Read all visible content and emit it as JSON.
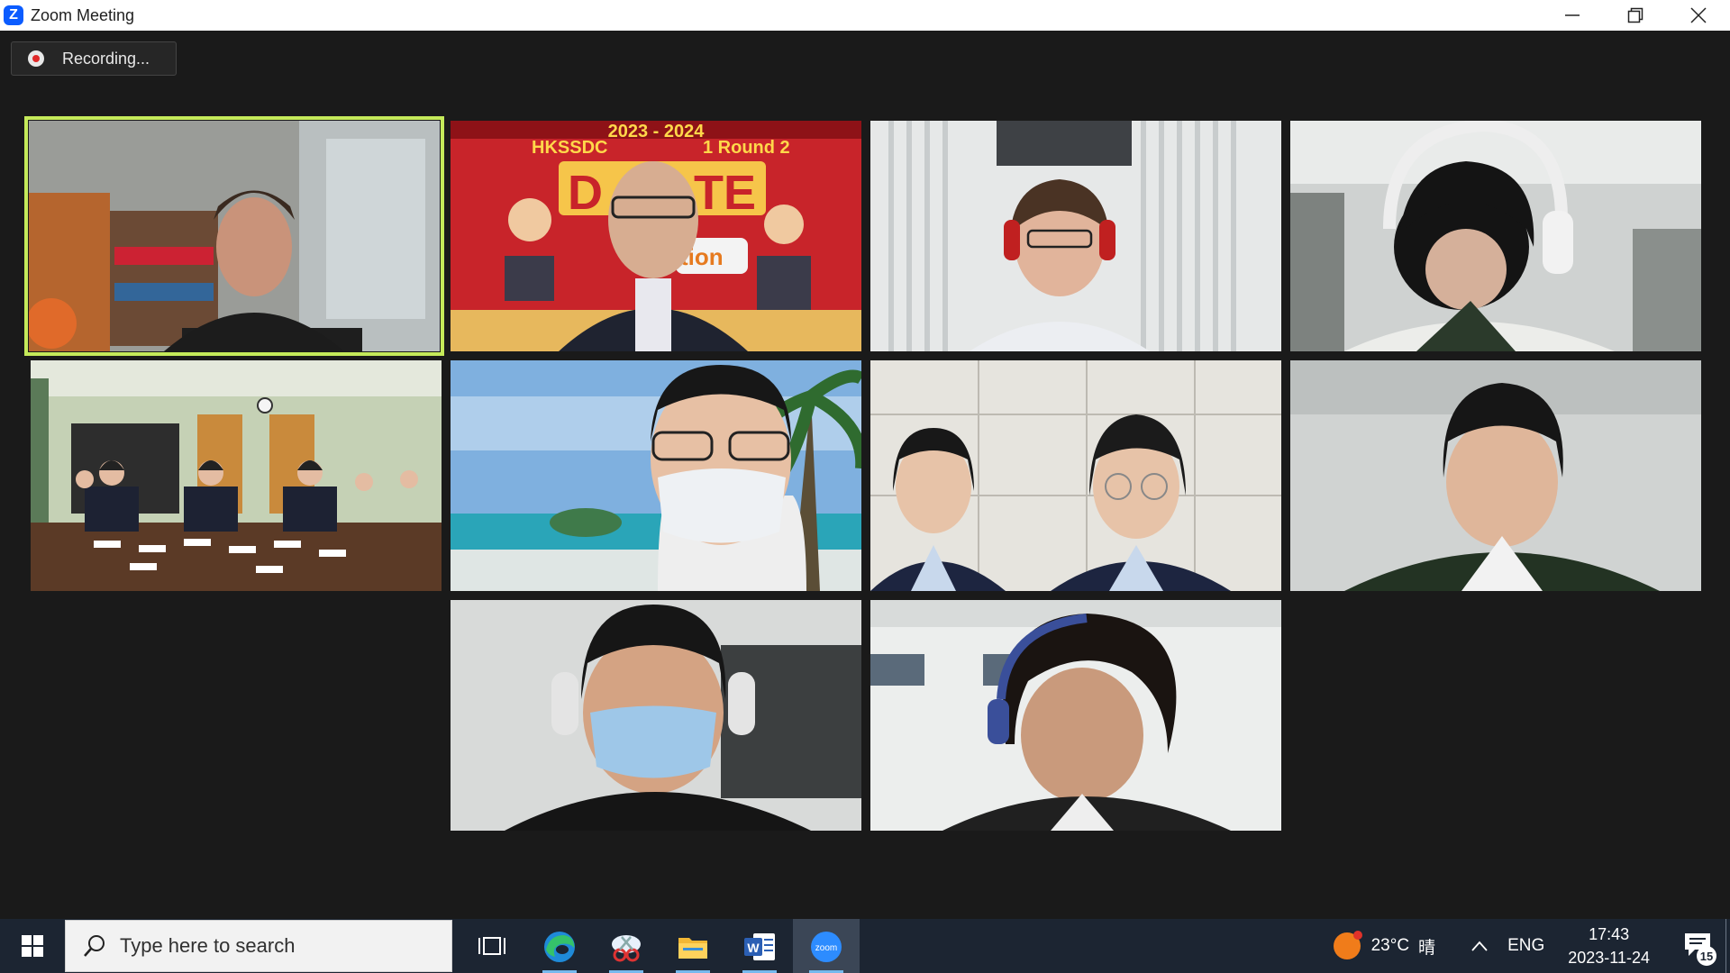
{
  "window": {
    "title": "Zoom Meeting",
    "logo_letter": "Z",
    "controls": [
      "minimize-icon",
      "restore-icon",
      "close-icon"
    ]
  },
  "meeting": {
    "recording_label": "Recording...",
    "active_speaker_border_color": "#c5ea5a",
    "tiles": [
      {
        "id": "participant-1",
        "active": true,
        "scene": "office with bookshelf"
      },
      {
        "id": "participant-2",
        "active": false,
        "scene": "debate virtual background",
        "background_text": [
          "2023 - 2024",
          "HKSSDC",
          "1 Round 2",
          "D",
          "TE",
          "tion"
        ]
      },
      {
        "id": "participant-3",
        "active": false,
        "scene": "woman with headphones"
      },
      {
        "id": "participant-4",
        "active": false,
        "scene": "student with headphones"
      },
      {
        "id": "participant-5",
        "active": false,
        "scene": "classroom team"
      },
      {
        "id": "participant-6",
        "active": false,
        "scene": "beach virtual background, masked"
      },
      {
        "id": "participant-7",
        "active": false,
        "scene": "two students"
      },
      {
        "id": "participant-8",
        "active": false,
        "scene": "student"
      },
      {
        "id": "participant-9",
        "active": false,
        "scene": "masked with headset"
      },
      {
        "id": "participant-10",
        "active": false,
        "scene": "student with headphones"
      }
    ]
  },
  "taskbar": {
    "search_placeholder": "Type here to search",
    "apps": [
      {
        "name": "task-view-icon"
      },
      {
        "name": "edge-icon"
      },
      {
        "name": "snipping-tool-icon"
      },
      {
        "name": "file-explorer-icon"
      },
      {
        "name": "word-icon"
      },
      {
        "name": "zoom-icon",
        "label": "zoom",
        "active": true
      }
    ],
    "weather": {
      "temp": "23°C",
      "condition": "晴"
    },
    "language": "ENG",
    "time": "17:43",
    "date": "2023-11-24",
    "notification_count": "15"
  }
}
